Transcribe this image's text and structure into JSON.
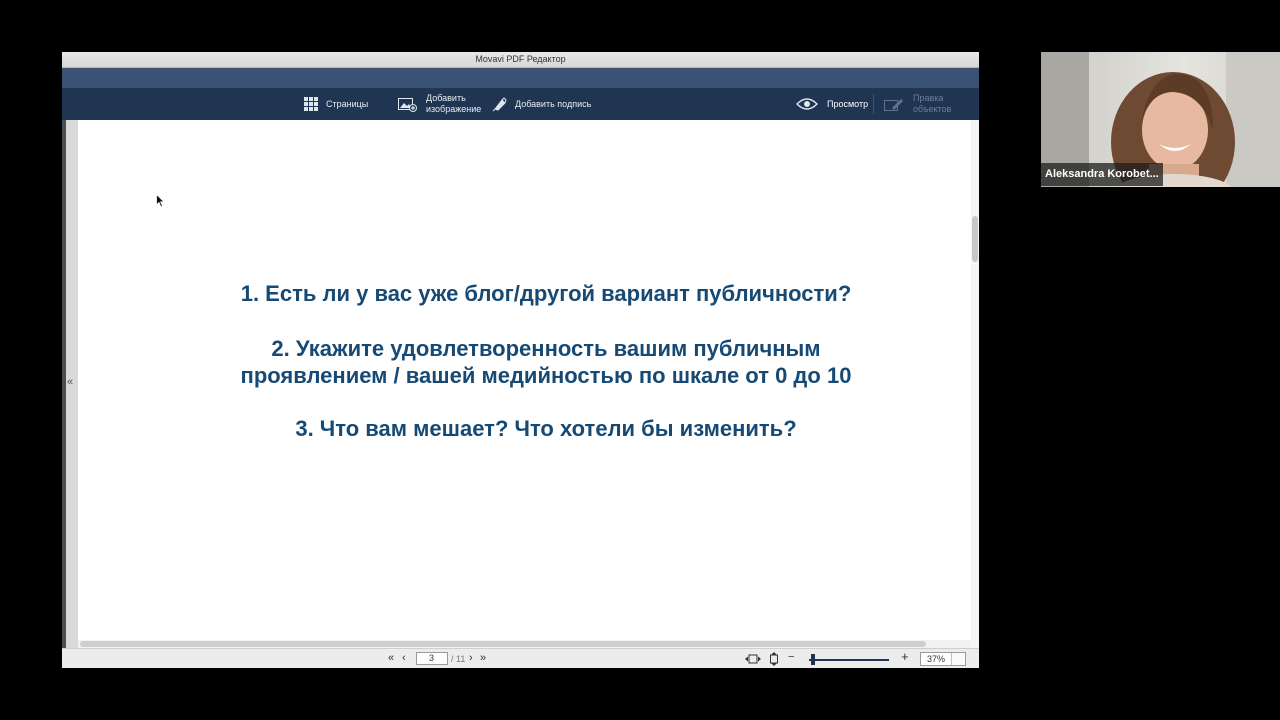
{
  "window": {
    "title": "Movavi PDF Редактор"
  },
  "toolbar": {
    "pages_label": "Страницы",
    "add_image_line1": "Добавить",
    "add_image_line2": "изображение",
    "add_signature_label": "Добавить подпись",
    "view_label": "Просмотр",
    "edit_objects_line1": "Правка",
    "edit_objects_line2": "объектов"
  },
  "slide": {
    "question_1": "1. Есть ли у вас уже блог/другой вариант публичности?",
    "question_2_line1": "2. Укажите удовлетворенность вашим публичным",
    "question_2_line2": "проявлением / вашей медийностью по шкале от 0 до 10",
    "question_3": "3. Что вам мешает? Что хотели бы изменить?"
  },
  "status_bar": {
    "first_page": "«",
    "prev_page": "‹",
    "current_page": "3",
    "total_pages": "/ 11",
    "next_page": "›",
    "last_page": "»",
    "zoom_out": "−",
    "zoom_in": "+",
    "zoom_level": "37%"
  },
  "video": {
    "participant_name": "Aleksandra Korobet..."
  },
  "colors": {
    "toolbar_bg": "#1f3552",
    "top_strip": "#3a5374",
    "slide_text": "#164a74"
  },
  "icons": [
    "grid-icon",
    "add-image-icon",
    "pen-icon",
    "eye-icon",
    "edit-objects-icon",
    "fit-width-icon",
    "fit-page-icon",
    "collapse-panel-icon",
    "cursor-icon"
  ]
}
